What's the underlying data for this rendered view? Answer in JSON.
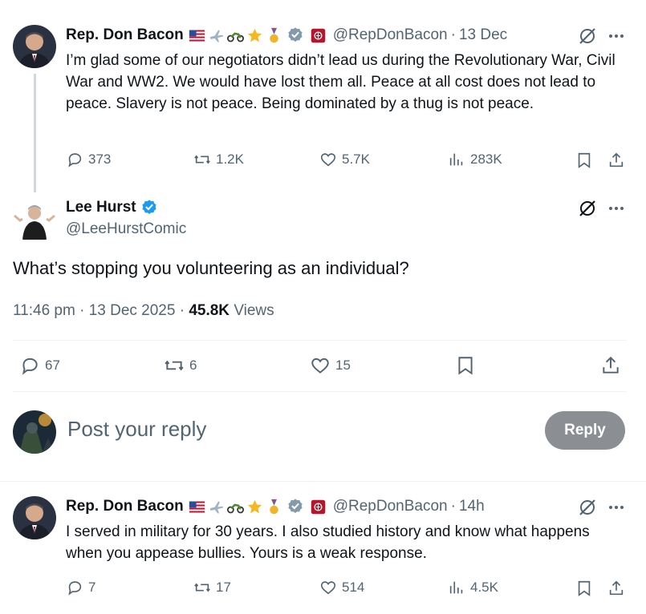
{
  "parent_tweet": {
    "name": "Rep. Don Bacon",
    "handle": "@RepDonBacon",
    "date": "13 Dec",
    "text": "I’m glad some of our negotiators didn’t lead us during the Revolutionary War, Civil War and WW2. We would have lost them all. Peace at all cost does not lead to peace. Slavery is not peace. Being dominated by a thug is not peace.",
    "replies": "373",
    "reposts": "1.2K",
    "likes": "5.7K",
    "views": "283K"
  },
  "main_tweet": {
    "name": "Lee Hurst",
    "handle": "@LeeHurstComic",
    "text": "What’s stopping you volunteering as an individual?",
    "timestamp": "11:46 pm · 13 Dec 2025 · ",
    "views_count": "45.8K",
    "views_label": "Views",
    "replies": "67",
    "reposts": "6",
    "likes": "15"
  },
  "reply_box": {
    "placeholder": "Post your reply",
    "button_label": "Reply"
  },
  "reply_tweet": {
    "name": "Rep. Don Bacon",
    "handle": "@RepDonBacon",
    "date": "14h",
    "text": "I served in military for 30 years. I also studied history and know what happens when you appease bullies. Yours is a weak response.",
    "replies": "7",
    "reposts": "17",
    "likes": "514",
    "views": "4.5K"
  },
  "colors": {
    "verified_blue": "#1d9bf0",
    "verified_gray": "#829aab",
    "muted": "#536471",
    "reply_button": "#8b8f94"
  }
}
